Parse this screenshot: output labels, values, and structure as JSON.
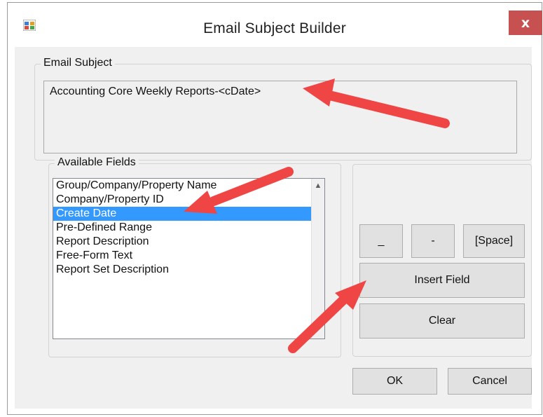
{
  "window": {
    "title": "Email Subject Builder",
    "close_label": "x"
  },
  "email_subject": {
    "group_label": "Email Subject",
    "value": "Accounting Core Weekly Reports-<cDate>"
  },
  "available_fields": {
    "group_label": "Available Fields",
    "items": [
      "Group/Company/Property Name",
      "Company/Property ID",
      "Create Date",
      "Pre-Defined Range",
      "Report Description",
      "Free-Form Text",
      "Report Set Description"
    ],
    "selected_index": 2
  },
  "buttons": {
    "underscore": "_",
    "hyphen": "-",
    "space": "[Space]",
    "insert_field": "Insert Field",
    "clear": "Clear",
    "ok": "OK",
    "cancel": "Cancel"
  },
  "colors": {
    "selection": "#3399ff",
    "close_button": "#c75050",
    "annotation_arrow": "#ef4545"
  }
}
